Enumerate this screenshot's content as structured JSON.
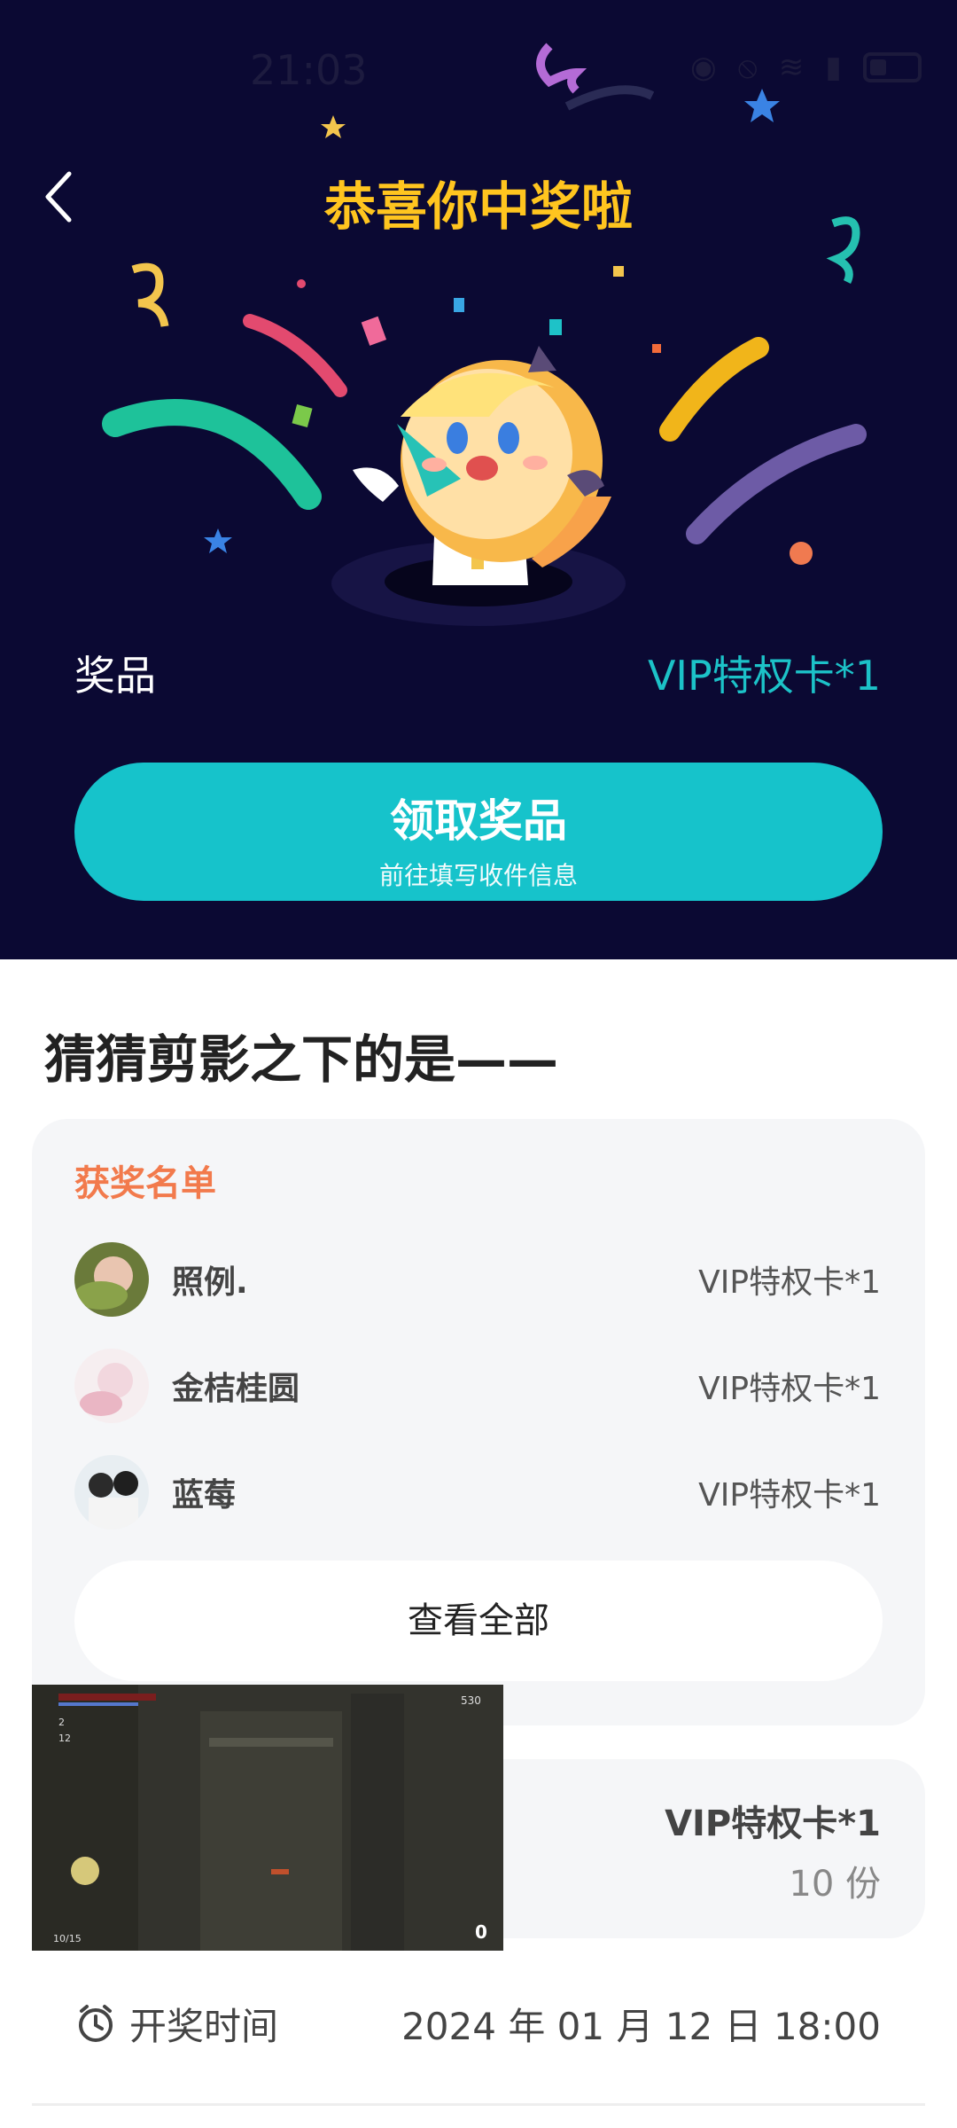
{
  "status_bar": {
    "time": "21:03"
  },
  "header": {
    "title": "恭喜你中奖啦",
    "back_icon": "chevron-left-icon"
  },
  "prize": {
    "label": "奖品",
    "value": "VIP特权卡*1"
  },
  "claim_button": {
    "title": "领取奖品",
    "subtitle": "前往填写收件信息"
  },
  "activity": {
    "title": "猜猜剪影之下的是——"
  },
  "winners": {
    "heading": "获奖名单",
    "items": [
      {
        "name": "照例.",
        "prize": "VIP特权卡*1"
      },
      {
        "name": "金桔桂圆",
        "prize": "VIP特权卡*1"
      },
      {
        "name": "蓝莓",
        "prize": "VIP特权卡*1"
      }
    ],
    "view_all_label": "查看全部"
  },
  "prize_card": {
    "name": "VIP特权卡*1",
    "count": "10 份"
  },
  "draw": {
    "label": "开奖时间",
    "time": "2024 年 01 月 12 日 18:00",
    "icon": "alarm-clock-icon"
  },
  "video_overlay": {
    "hud_score": "530",
    "hud_counter": "10/15",
    "hud_item_1": "2",
    "hud_item_2": "12",
    "hud_ammo": "0"
  },
  "colors": {
    "hero_bg": "#0b0933",
    "title": "#ffc51f",
    "accent": "#16c3cb",
    "winners_heading": "#f27a4c"
  }
}
